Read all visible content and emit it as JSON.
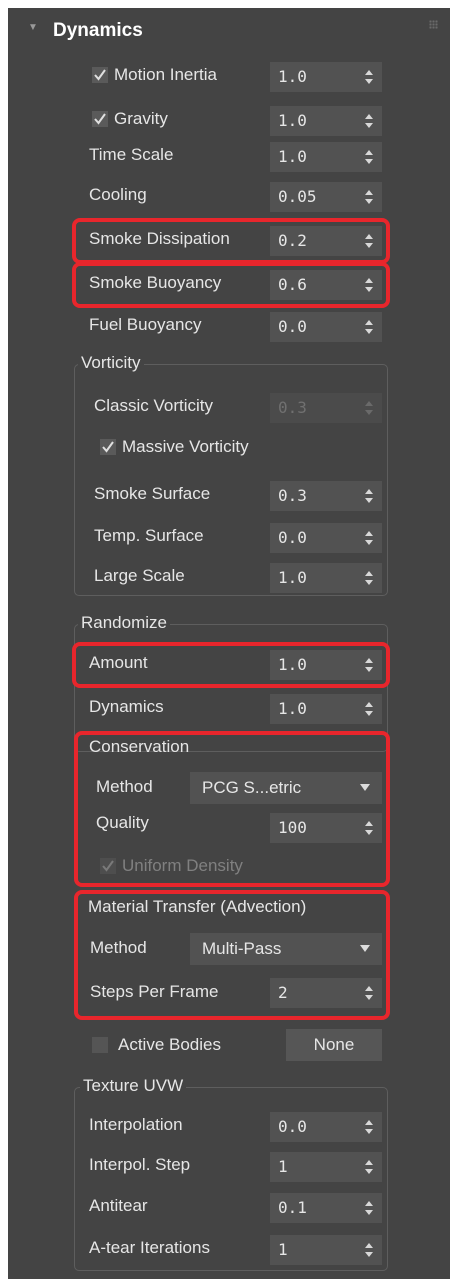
{
  "section": {
    "title": "Dynamics"
  },
  "params": {
    "motion_inertia": {
      "label": "Motion Inertia",
      "value": "1.0",
      "checked": true
    },
    "gravity": {
      "label": "Gravity",
      "value": "1.0",
      "checked": true
    },
    "time_scale": {
      "label": "Time Scale",
      "value": "1.0"
    },
    "cooling": {
      "label": "Cooling",
      "value": "0.05"
    },
    "smoke_dissipation": {
      "label": "Smoke Dissipation",
      "value": "0.2"
    },
    "smoke_buoyancy": {
      "label": "Smoke Buoyancy",
      "value": "0.6"
    },
    "fuel_buoyancy": {
      "label": "Fuel Buoyancy",
      "value": "0.0"
    }
  },
  "vorticity": {
    "title": "Vorticity",
    "classic": {
      "label": "Classic Vorticity",
      "value": "0.3",
      "enabled": false
    },
    "massive": {
      "label": "Massive Vorticity",
      "checked": true
    },
    "smoke_surface": {
      "label": "Smoke Surface",
      "value": "0.3"
    },
    "temp_surface": {
      "label": "Temp. Surface",
      "value": "0.0"
    },
    "large_scale": {
      "label": "Large Scale",
      "value": "1.0"
    }
  },
  "randomize": {
    "title": "Randomize",
    "amount": {
      "label": "Amount",
      "value": "1.0"
    },
    "dynamics": {
      "label": "Dynamics",
      "value": "1.0"
    }
  },
  "conservation": {
    "title": "Conservation",
    "method": {
      "label": "Method",
      "value": "PCG S...etric"
    },
    "quality": {
      "label": "Quality",
      "value": "100"
    },
    "uniform_density": {
      "label": "Uniform Density",
      "checked": true,
      "enabled": false
    }
  },
  "material_transfer": {
    "title": "Material Transfer (Advection)",
    "method": {
      "label": "Method",
      "value": "Multi-Pass"
    },
    "steps": {
      "label": "Steps Per Frame",
      "value": "2"
    }
  },
  "active_bodies": {
    "label": "Active Bodies",
    "button": "None",
    "checked": false
  },
  "texture_uvw": {
    "title": "Texture UVW",
    "interpolation": {
      "label": "Interpolation",
      "value": "0.0"
    },
    "interpol_step": {
      "label": "Interpol. Step",
      "value": "1"
    },
    "antitear": {
      "label": "Antitear",
      "value": "0.1"
    },
    "atear_iterations": {
      "label": "A-tear Iterations",
      "value": "1"
    }
  },
  "colors": {
    "panel": "#444444",
    "field": "#525252",
    "highlight": "#e8262c",
    "text": "#e6e6e6"
  }
}
